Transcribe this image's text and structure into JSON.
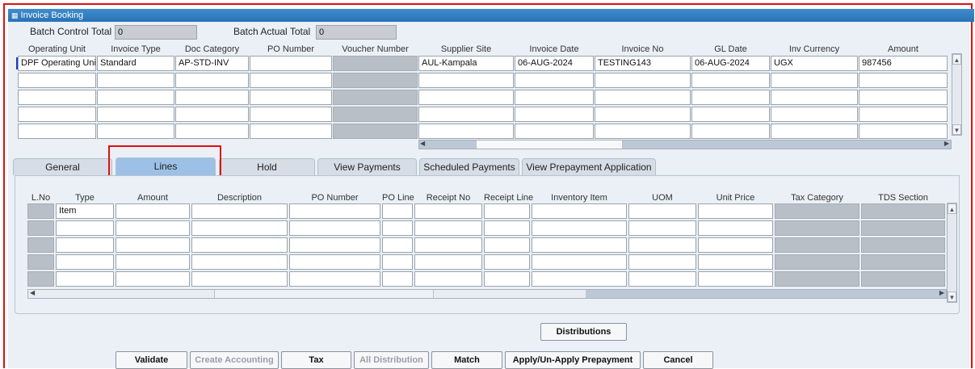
{
  "window": {
    "title": "Invoice Booking"
  },
  "batch": {
    "control_label": "Batch Control Total",
    "control_value": "0",
    "actual_label": "Batch Actual Total",
    "actual_value": "0"
  },
  "header_columns": [
    "Operating Unit",
    "Invoice Type",
    "Doc Category",
    "PO Number",
    "Voucher Number",
    "Supplier Site",
    "Invoice Date",
    "Invoice No",
    "GL Date",
    "Inv Currency",
    "Amount"
  ],
  "header_rows": [
    [
      "DPF Operating Uni",
      "Standard",
      "AP-STD-INV",
      "",
      "",
      "AUL-Kampala",
      "06-AUG-2024",
      "TESTING143",
      "06-AUG-2024",
      "UGX",
      "987456"
    ],
    [
      "",
      "",
      "",
      "",
      "",
      "",
      "",
      "",
      "",
      "",
      ""
    ],
    [
      "",
      "",
      "",
      "",
      "",
      "",
      "",
      "",
      "",
      "",
      ""
    ],
    [
      "",
      "",
      "",
      "",
      "",
      "",
      "",
      "",
      "",
      "",
      ""
    ],
    [
      "",
      "",
      "",
      "",
      "",
      "",
      "",
      "",
      "",
      "",
      ""
    ]
  ],
  "tabs": [
    "General",
    "Lines",
    "Hold",
    "View Payments",
    "Scheduled Payments",
    "View Prepayment Application"
  ],
  "active_tab": "Lines",
  "line_columns": [
    "L.No",
    "Type",
    "Amount",
    "Description",
    "PO Number",
    "PO Line",
    "Receipt No",
    "Receipt Line",
    "Inventory Item",
    "UOM",
    "Unit Price",
    "Tax Category",
    "TDS Section"
  ],
  "line_rows": [
    [
      "",
      "Item",
      "",
      "",
      "",
      "",
      "",
      "",
      "",
      "",
      "",
      "",
      ""
    ],
    [
      "",
      "",
      "",
      "",
      "",
      "",
      "",
      "",
      "",
      "",
      "",
      "",
      ""
    ],
    [
      "",
      "",
      "",
      "",
      "",
      "",
      "",
      "",
      "",
      "",
      "",
      "",
      ""
    ],
    [
      "",
      "",
      "",
      "",
      "",
      "",
      "",
      "",
      "",
      "",
      "",
      "",
      ""
    ],
    [
      "",
      "",
      "",
      "",
      "",
      "",
      "",
      "",
      "",
      "",
      "",
      "",
      ""
    ]
  ],
  "buttons": {
    "distributions": "Distributions",
    "validate": "Validate",
    "create_accounting": "Create Accounting",
    "tax": "Tax",
    "all_distribution": "All Distribution",
    "match": "Match",
    "apply_prepayment": "Apply/Un-Apply Prepayment",
    "cancel": "Cancel"
  },
  "colors": {
    "title_bar": "#2a73b5",
    "highlight_border": "#e01010",
    "active_tab": "#9cc0e6",
    "panel": "#eaf0f6"
  }
}
